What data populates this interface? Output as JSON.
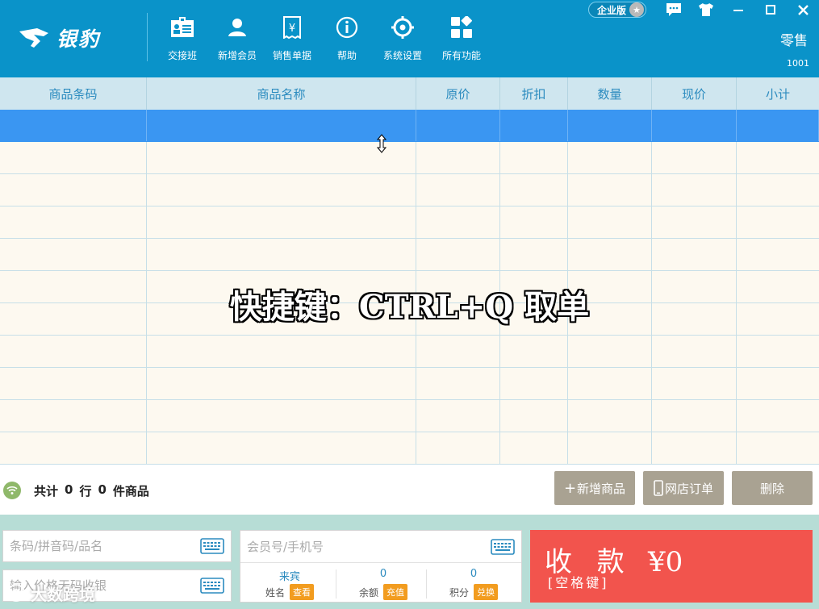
{
  "brand": {
    "name": "银豹"
  },
  "nav": [
    {
      "label": "交接班",
      "icon": "shift-handover-icon"
    },
    {
      "label": "新增会员",
      "icon": "add-member-icon"
    },
    {
      "label": "销售单据",
      "icon": "sales-receipt-icon"
    },
    {
      "label": "帮助",
      "icon": "help-icon"
    },
    {
      "label": "系统设置",
      "icon": "settings-icon"
    },
    {
      "label": "所有功能",
      "icon": "all-functions-icon"
    }
  ],
  "window": {
    "edition": "企业版",
    "mode": "零售",
    "store_no": "1001"
  },
  "table": {
    "columns": [
      "商品条码",
      "商品名称",
      "原价",
      "折扣",
      "数量",
      "现价",
      "小计"
    ],
    "row_count": 11,
    "selected_row": 0
  },
  "overlay": {
    "shortcut_text": "快捷键：CTRL+Q 取单"
  },
  "summary": {
    "prefix": "共计",
    "rows": "0",
    "rows_unit": "行",
    "items": "0",
    "items_unit": "件商品"
  },
  "actions": {
    "add_product": "新增商品",
    "online_orders": "网店订单",
    "delete": "删除"
  },
  "inputs": {
    "barcode_placeholder": "条码/拼音码/品名",
    "no_code_placeholder": "输入价格无码收银",
    "member_placeholder": "会员号/手机号"
  },
  "member": {
    "name_value": "来宾",
    "name_label": "姓名",
    "name_action": "查看",
    "balance_value": "0",
    "balance_label": "余额",
    "balance_action": "充值",
    "points_value": "0",
    "points_label": "积分",
    "points_action": "兑换"
  },
  "checkout": {
    "title": "收 款",
    "hint": "[空格键]",
    "amount": "¥0"
  },
  "watermark": {
    "text": "大数跨境"
  },
  "colors": {
    "header": "#0a93c9",
    "selected_row": "#3a96f2",
    "checkout": "#f2544d",
    "action_gray": "#a9a292",
    "tag_orange": "#f29c1f"
  }
}
